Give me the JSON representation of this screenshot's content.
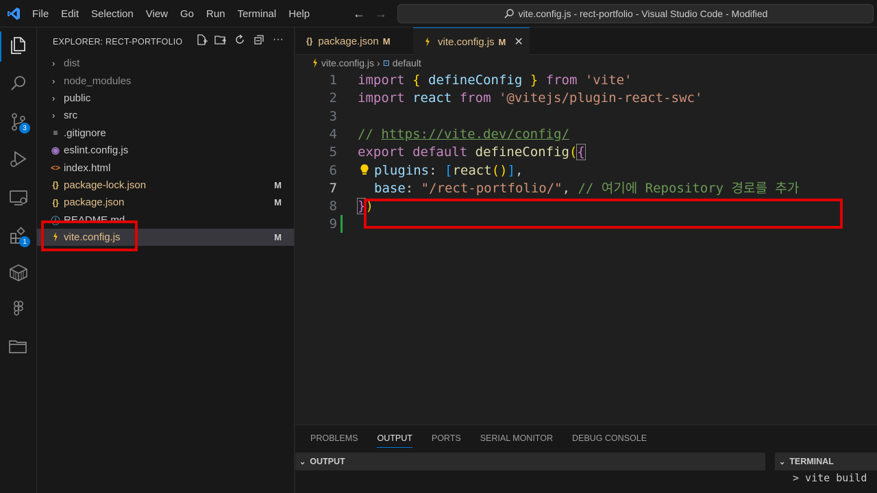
{
  "colors": {
    "accent": "#0078d4",
    "highlight_box": "#e00000",
    "modified": "#e2c08d"
  },
  "titlebar": {
    "menu": [
      "File",
      "Edit",
      "Selection",
      "View",
      "Go",
      "Run",
      "Terminal",
      "Help"
    ],
    "window_title": "vite.config.js - rect-portfolio - Visual Studio Code - Modified"
  },
  "activity_bar": {
    "items": [
      "explorer-icon",
      "search-icon",
      "source-control-icon",
      "run-debug-icon",
      "remote-explorer-icon",
      "extensions-icon",
      "packages-icon",
      "figma-icon",
      "folder-icon"
    ],
    "source_control_badge": "3",
    "extensions_badge": "1"
  },
  "sidebar": {
    "header": "EXPLORER: RECT-PORTFOLIO",
    "items": [
      {
        "label": "dist",
        "type": "folder"
      },
      {
        "label": "node_modules",
        "type": "folder"
      },
      {
        "label": "public",
        "type": "folder"
      },
      {
        "label": "src",
        "type": "folder"
      },
      {
        "label": ".gitignore",
        "type": "file",
        "icon": "lines-icon"
      },
      {
        "label": "eslint.config.js",
        "type": "file",
        "icon": "eslint-icon"
      },
      {
        "label": "index.html",
        "type": "file",
        "icon": "html-icon"
      },
      {
        "label": "package-lock.json",
        "type": "file",
        "icon": "json-icon",
        "status": "M"
      },
      {
        "label": "package.json",
        "type": "file",
        "icon": "json-icon",
        "status": "M"
      },
      {
        "label": "README.md",
        "type": "file",
        "icon": "info-icon"
      },
      {
        "label": "vite.config.js",
        "type": "file",
        "icon": "vite-icon",
        "status": "M"
      }
    ]
  },
  "editor": {
    "tabs": [
      {
        "label": "package.json",
        "status": "M",
        "icon": "{}"
      },
      {
        "label": "vite.config.js",
        "status": "M",
        "icon": "vite-icon",
        "close": "✕"
      }
    ],
    "breadcrumb": {
      "file": "vite.config.js",
      "symbol": "default"
    },
    "lines": [
      {
        "n": "1"
      },
      {
        "n": "2"
      },
      {
        "n": "3"
      },
      {
        "n": "4"
      },
      {
        "n": "5"
      },
      {
        "n": "6"
      },
      {
        "n": "7"
      },
      {
        "n": "8"
      },
      {
        "n": "9"
      }
    ],
    "code": {
      "l1": {
        "kw1": "import",
        "b1": "{",
        "fn": "defineConfig",
        "b2": "}",
        "kw2": "from",
        "str": "'vite'"
      },
      "l2": {
        "kw1": "import",
        "var": "react",
        "kw2": "from",
        "str": "'@vitejs/plugin-react-swc'"
      },
      "l4": {
        "slashes": "//",
        "url": "https://vite.dev/config/"
      },
      "l5": {
        "kw1": "export",
        "kw2": "default",
        "fn": "defineConfig",
        "p": "(",
        "b": "{"
      },
      "l6": {
        "prop": "plugins",
        "colon": ":",
        "ob": "[",
        "fn": "react",
        "paren": "()",
        "cb": "]",
        "comma": ","
      },
      "l7": {
        "prop": "base",
        "colon": ":",
        "str": "\"/rect-portfolio/\"",
        "comma": ",",
        "comment": "// 여기에 Repository 경로를 추가"
      },
      "l8": {
        "b": "}",
        "p": ")"
      }
    }
  },
  "panel": {
    "tabs": [
      "PROBLEMS",
      "OUTPUT",
      "PORTS",
      "SERIAL MONITOR",
      "DEBUG CONSOLE"
    ],
    "active_tab": "OUTPUT",
    "output_label": "OUTPUT",
    "terminal_label": "TERMINAL",
    "terminal_text": "> vite build"
  }
}
